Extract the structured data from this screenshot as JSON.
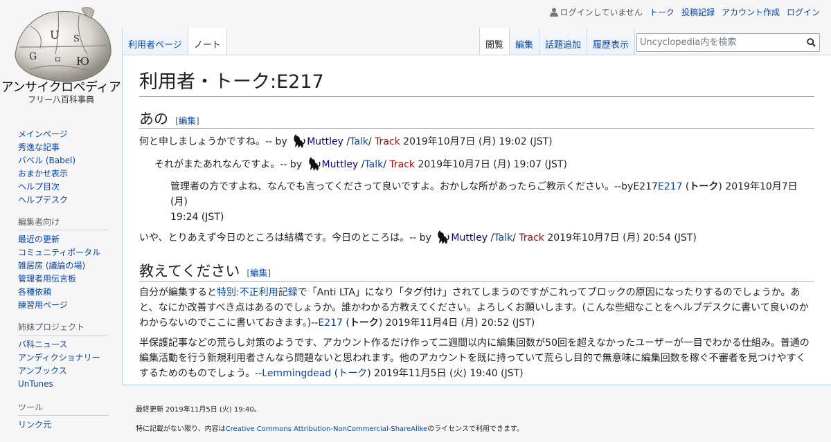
{
  "site": {
    "wordmark": "アンサイクロペディア",
    "tagline": "フリー八百科事典"
  },
  "personal": {
    "not_logged_in": "ログインしていません",
    "talk": "トーク",
    "contributions": "投稿記録",
    "create_account": "アカウント作成",
    "login": "ログイン"
  },
  "tabs_left": [
    {
      "label": "利用者ページ",
      "selected": false
    },
    {
      "label": "ノート",
      "selected": true
    }
  ],
  "tabs_right": [
    {
      "label": "閲覧",
      "selected": true
    },
    {
      "label": "編集",
      "selected": false
    },
    {
      "label": "話題追加",
      "selected": false
    },
    {
      "label": "履歴表示",
      "selected": false
    }
  ],
  "search": {
    "placeholder": "Uncyclopedia内を検索"
  },
  "page": {
    "title": "利用者・トーク:E217",
    "edit_label": "編集",
    "section1_title": "あの",
    "section2_title": "教えてください",
    "muttley": "Muttley",
    "talk_link": "Talk",
    "track_link": "Track",
    "by": "-- by",
    "s1": {
      "l1_text": "何と申しましょうかですね。",
      "l1_date": "2019年10月7日 (月) 19:02 (JST)",
      "l2_text": "それがまたあれなんですよ。",
      "l2_date": "2019年10月7日 (月) 19:07 (JST)",
      "l3_text": "管理者の方ですよね、なんでも言ってくださって良いですよ。おかしな所があったらご教示ください。--byE217",
      "l3_user": "E217",
      "l3_talk": "トーク",
      "l3_date": "2019年10月7日 (月)",
      "l3_time": "19:24 (JST)",
      "l4_text": "いや、とりあえず今日のところは結構です。今日のところは。",
      "l4_date": "2019年10月7日 (月) 20:54 (JST)"
    },
    "s2": {
      "p1_a": "自分が編集すると",
      "p1_link": "特別:不正利用記録",
      "p1_b": "で「Anti LTA」になり「タグ付け」されてしまうのですがこれってブロックの原因になったりするのでしょうか。あ",
      "p1_c": "と、なにか改善すべき点はあるのでしょうか。誰かわかる方教えてください。よろしくお願いします。(こんな些細なことをヘルプデスクに書いて良いのか",
      "p1_d": "わからないのでここに書いておきます。)--",
      "p1_user": "E217",
      "p1_talk": "トーク",
      "p1_date": "2019年11月4日 (月) 20:52 (JST)",
      "p2_a": "半保護記事などの荒らし対策のようです、アカウント作るだけ作って二週間以内に編集回数が50回を超えなかったユーザーが一目でわかる仕組み。普通の",
      "p2_b": "編集活動を行う新規利用者さんなら問題ないと思われます。他のアカウントを既に持っていて荒らし目的で無意味に編集回数を稼ぐ不審者を見つけやすく",
      "p2_c": "するためのものでしょう。--",
      "p2_user": "Lemmingdead",
      "p2_talk": "トーク",
      "p2_date": "2019年11月5日 (火) 19:40 (JST)"
    }
  },
  "sidebar": {
    "nav": [
      "メインページ",
      "秀逸な記事",
      "バベル (Babel)",
      "おまかせ表示",
      "ヘルプ目次",
      "ヘルプデスク"
    ],
    "editors_heading": "編集者向け",
    "editors": [
      "最近の更新",
      "コミュニティポータル",
      "雑居房 (議論の場)",
      "管理者用伝言板",
      "各種依頼",
      "練習用ページ"
    ],
    "sister_heading": "姉妹プロジェクト",
    "sister": [
      "バ科ニュース",
      "アンディクショナリー",
      "アンブックス",
      "UnTunes"
    ],
    "tools_heading": "ツール",
    "tools": [
      "リンク元"
    ]
  },
  "footer": {
    "last_modified": "最終更新 2019年11月5日 (火) 19:40。",
    "license_a": "特に記載がない限り、内容は",
    "license_link": "Creative Commons Attribution-NonCommercial-ShareAlike",
    "license_b": "のライセンスで利用できます。"
  }
}
